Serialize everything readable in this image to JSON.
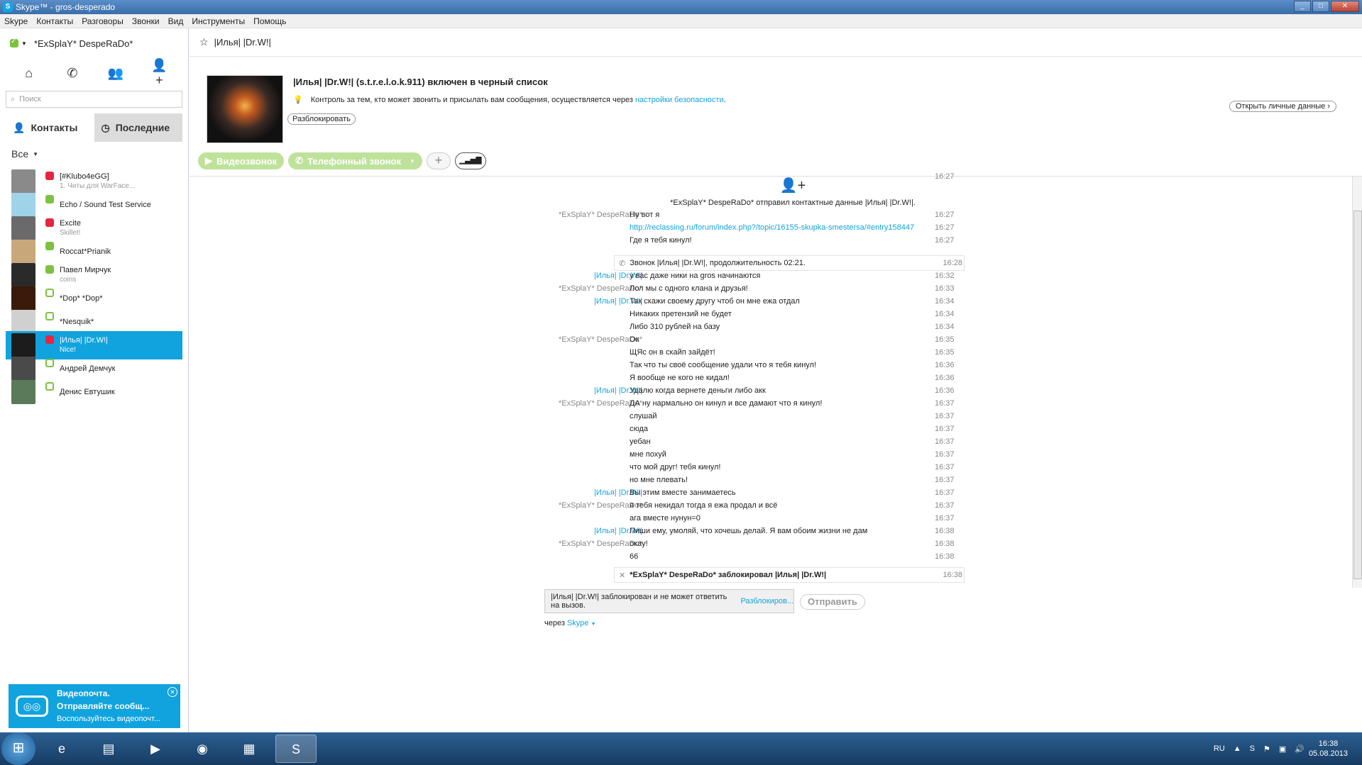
{
  "window": {
    "title": "Skype™ - gros-desperado"
  },
  "menu": [
    "Skype",
    "Контакты",
    "Разговоры",
    "Звонки",
    "Вид",
    "Инструменты",
    "Помощь"
  ],
  "profile": {
    "name": "*ExSplaY* DespeRaDo*"
  },
  "search": {
    "placeholder": "Поиск"
  },
  "tabs": {
    "contacts": "Контакты",
    "recent": "Последние"
  },
  "filter": {
    "label": "Все"
  },
  "contacts": [
    {
      "name": "[#Klubo4eGG]",
      "sub": "1. Читы для WarFace...",
      "status": "red",
      "color": "#8a8a8a"
    },
    {
      "name": "Echo / Sound Test Service",
      "sub": "",
      "status": "green",
      "color": "#9fd3e8"
    },
    {
      "name": "Excite",
      "sub": "Skillet!",
      "status": "red",
      "color": "#6a6a6a"
    },
    {
      "name": "Roccat*Prianik",
      "sub": "",
      "status": "green",
      "color": "#c8a87a"
    },
    {
      "name": "Павел Мирчук",
      "sub": "coins",
      "status": "green",
      "color": "#2a2a2a"
    },
    {
      "name": "*Dop* *Dop*",
      "sub": "",
      "status": "off",
      "color": "#3a1a0a"
    },
    {
      "name": "*Nesquik*",
      "sub": "",
      "status": "off",
      "color": "#d0d0d0"
    },
    {
      "name": "|Илья| |Dr.W!|",
      "sub": "Nice!",
      "status": "red",
      "color": "#1c1c1c",
      "selected": true
    },
    {
      "name": "Андрей Демчук",
      "sub": "",
      "status": "off",
      "color": "#4a4a4a"
    },
    {
      "name": "Денис Евтушик",
      "sub": "",
      "status": "off",
      "color": "#5a7a5a"
    }
  ],
  "voicemail": {
    "title": "Видеопочта.",
    "line1": "Отправляйте сообщ...",
    "line2": "Воспользуйтесь видеопочт..."
  },
  "chat": {
    "title": "|Илья| |Dr.W!|",
    "blocked_title": "|Илья| |Dr.W!| (s.t.r.e.l.o.k.911) включен в черный список",
    "security_text": "Контроль за тем, кто может звонить и присылать вам сообщения, осуществляется через",
    "security_link": "настройки безопасности",
    "unblock": "Разблокировать",
    "open_profile": "Открыть личные данные",
    "video_call": "Видеозвонок",
    "phone_call": "Телефонный звонок",
    "contact_sent_time": "16:27",
    "contact_sent": "*ExSplaY* DespeRaDo* отправил контактные данные |Илья| |Dr.W!|.",
    "call_line": "Звонок |Илья| |Dr.W!|, продолжительность 02:21.",
    "call_time": "16:28",
    "blocked_line": "*ExSplaY* DespeRaDo* заблокировал |Илья| |Dr.W!|",
    "blocked_time": "16:38",
    "composer_text": "|Илья| |Dr.W!| заблокирован и не может ответить на вызов.",
    "composer_link": "Разблокиров...",
    "send": "Отправить",
    "via_text": "через",
    "via_link": "Skype"
  },
  "messages": [
    {
      "sender": "*ExSplaY* DespeRaDo*",
      "text": "Ну вот я",
      "time": "16:27"
    },
    {
      "sender": "",
      "text": "http://reclassing.ru/forum/index.php?/topic/16155-skupka-smestersa/#entry158447",
      "time": "16:27",
      "link": true
    },
    {
      "sender": "",
      "text": "Где я тебя кинул!",
      "time": "16:27"
    },
    {
      "sender": "|Илья| |Dr.W!|",
      "text": "у вас даже ники на gros начинаются",
      "time": "16:32",
      "ilya": true
    },
    {
      "sender": "*ExSplaY* DespeRaDo*",
      "text": "Лол мы с одного клана и друзья!",
      "time": "16:33"
    },
    {
      "sender": "|Илья| |Dr.W!|",
      "text": "Так скажи своему другу чтоб он мне ежа отдал",
      "time": "16:34",
      "ilya": true
    },
    {
      "sender": "",
      "text": "Никаких претензий не будет",
      "time": "16:34"
    },
    {
      "sender": "",
      "text": "Либо 310 рублей на базу",
      "time": "16:34"
    },
    {
      "sender": "*ExSplaY* DespeRaDo*",
      "text": "Ок",
      "time": "16:35"
    },
    {
      "sender": "",
      "text": "ЩЯс он в скайп зайдёт!",
      "time": "16:35"
    },
    {
      "sender": "",
      "text": "Так что ты своё сообщение удали что я тебя кинул!",
      "time": "16:36"
    },
    {
      "sender": "",
      "text": "Я вообще не кого не кидал!",
      "time": "16:36"
    },
    {
      "sender": "|Илья| |Dr.W!|",
      "text": "Удалю когда вернете деньги либо акк",
      "time": "16:36",
      "ilya": true
    },
    {
      "sender": "*ExSplaY* DespeRaDo*",
      "text": "ДА ну нармально он кинул и все дамают что я кинул!",
      "time": "16:37"
    },
    {
      "sender": "",
      "text": "слушай",
      "time": "16:37"
    },
    {
      "sender": "",
      "text": "сюда",
      "time": "16:37"
    },
    {
      "sender": "",
      "text": "уебан",
      "time": "16:37"
    },
    {
      "sender": "",
      "text": "мне похуй",
      "time": "16:37"
    },
    {
      "sender": "",
      "text": "что мой друг! тебя кинул!",
      "time": "16:37"
    },
    {
      "sender": "",
      "text": "но мне плевать!",
      "time": "16:37"
    },
    {
      "sender": "|Илья| |Dr.W!|",
      "text": "Вы этим вместе занимаетесь",
      "time": "16:37",
      "ilya": true
    },
    {
      "sender": "*ExSplaY* DespeRaDo*",
      "text": "я тебя некидал тогда я ежа продал и всё",
      "time": "16:37"
    },
    {
      "sender": "",
      "text": "ага вместе нунун=0",
      "time": "16:37"
    },
    {
      "sender": "|Илья| |Dr.W!|",
      "text": "Пиши ему, умоляй, что хочешь делай. Я вам обоим жизни не дам",
      "time": "16:38",
      "ilya": true
    },
    {
      "sender": "*ExSplaY* DespeRaDo*",
      "text": "окау!",
      "time": "16:38"
    },
    {
      "sender": "",
      "text": "66",
      "time": "16:38"
    }
  ],
  "tray": {
    "lang": "RU",
    "time": "16:38",
    "date": "05.08.2013"
  }
}
